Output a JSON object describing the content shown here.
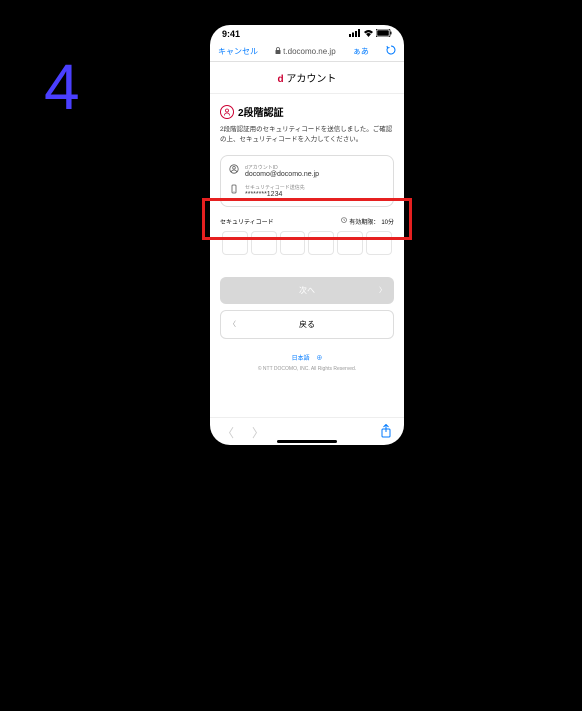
{
  "step_number": "4",
  "status": {
    "time": "9:41"
  },
  "browser": {
    "cancel": "キャンセル",
    "url": "t.docomo.ne.jp",
    "aa": "ぁあ"
  },
  "header": {
    "logo_d": "d",
    "logo_text": " アカウント"
  },
  "content": {
    "title": "2段階認証",
    "desc": "2段階認証用のセキュリティコードを送信しました。ご確認の上、セキュリティコードを入力してください。",
    "account_label": "dアカウントID",
    "account_value": "docomo@docomo.ne.jp",
    "dest_label": "セキュリティコード送信先",
    "dest_value": "********1234",
    "code_label": "セキュリティコード",
    "code_expiry_prefix": "有効期限：",
    "code_expiry_value": "10分",
    "next_btn": "次へ",
    "back_btn": "戻る",
    "lang": "日本語",
    "lang_icon": "⊕",
    "copyright": "© NTT DOCOMO, INC. All Rights Reserved."
  }
}
